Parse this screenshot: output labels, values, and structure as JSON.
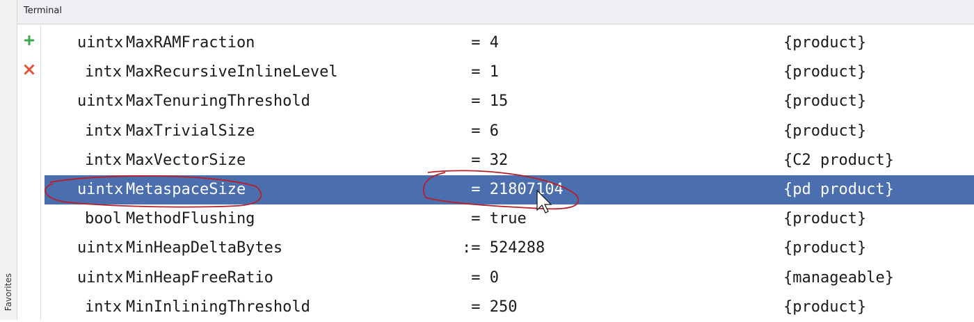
{
  "panel": {
    "title": "Terminal",
    "side_tab": "Favorites"
  },
  "toolbar": {
    "add_icon": "plus-icon",
    "close_icon": "close-icon",
    "add_color": "#3aa84a",
    "close_color": "#e0553a"
  },
  "selection_color": "#4b6eaf",
  "rows": [
    {
      "type": "uintx",
      "name": "MaxRAMFraction",
      "assign": " =",
      "value": "4",
      "origin": "{product}"
    },
    {
      "type": "intx",
      "name": "MaxRecursiveInlineLevel",
      "assign": " =",
      "value": "1",
      "origin": "{product}"
    },
    {
      "type": "uintx",
      "name": "MaxTenuringThreshold",
      "assign": " =",
      "value": "15",
      "origin": "{product}"
    },
    {
      "type": "intx",
      "name": "MaxTrivialSize",
      "assign": " =",
      "value": "6",
      "origin": "{product}"
    },
    {
      "type": "intx",
      "name": "MaxVectorSize",
      "assign": " =",
      "value": "32",
      "origin": "{C2 product}"
    },
    {
      "type": "uintx",
      "name": "MetaspaceSize",
      "assign": " =",
      "value": "21807104",
      "origin": "{pd product}",
      "selected": true
    },
    {
      "type": "bool",
      "name": "MethodFlushing",
      "assign": " =",
      "value": "true",
      "origin": "{product}"
    },
    {
      "type": "uintx",
      "name": "MinHeapDeltaBytes",
      "assign": ":=",
      "value": "524288",
      "origin": "{product}"
    },
    {
      "type": "uintx",
      "name": "MinHeapFreeRatio",
      "assign": " =",
      "value": "0",
      "origin": "{manageable}"
    },
    {
      "type": "intx",
      "name": "MinInliningThreshold",
      "assign": " =",
      "value": "250",
      "origin": "{product}"
    }
  ]
}
